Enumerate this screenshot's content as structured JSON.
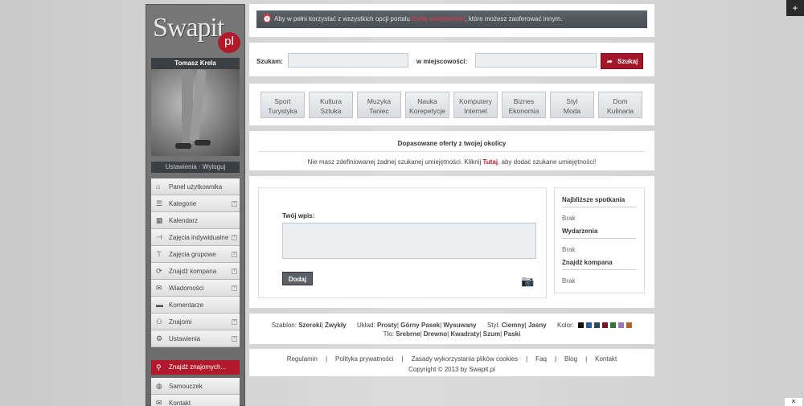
{
  "corner": {
    "top_label": "+",
    "bottom_label": "✕"
  },
  "sidebar": {
    "logo_text": "Swapit",
    "logo_badge": "pl",
    "user_name": "Tomasz Krela",
    "user_links": "Ustawienia · Wyloguj",
    "menu": [
      {
        "label": "Panel użytkownika",
        "icon": "home-icon",
        "glyph": "⌂",
        "expandable": false
      },
      {
        "label": "Kategorie",
        "icon": "list-icon",
        "glyph": "☰",
        "expandable": true
      },
      {
        "label": "Kalendarz",
        "icon": "calendar-icon",
        "glyph": "▦",
        "expandable": false
      },
      {
        "label": "Zajęcia indywidualne",
        "icon": "signpost-icon",
        "glyph": "⊣",
        "expandable": true
      },
      {
        "label": "Zajęcia grupowe",
        "icon": "signpost-icon",
        "glyph": "⊤",
        "expandable": true
      },
      {
        "label": "Znajdź kompana",
        "icon": "refresh-icon",
        "glyph": "⟳",
        "expandable": true
      },
      {
        "label": "Wiadomości",
        "icon": "mail-icon",
        "glyph": "✉",
        "expandable": true
      },
      {
        "label": "Komentarze",
        "icon": "comment-icon",
        "glyph": "▬",
        "expandable": false
      },
      {
        "label": "Znajomi",
        "icon": "users-icon",
        "glyph": "⚇",
        "expandable": true
      },
      {
        "label": "Ustawienia",
        "icon": "gear-icon",
        "glyph": "⚙",
        "expandable": true
      }
    ],
    "find_friends_placeholder": "Znajdź znajomych...",
    "menu2": [
      {
        "label": "Samouczek",
        "icon": "globe-icon",
        "glyph": "◍"
      },
      {
        "label": "Kontakt",
        "icon": "mail-icon",
        "glyph": "✉"
      }
    ]
  },
  "notice": {
    "prefix": "Aby w pełni korzystać z wszystkich opcji portalu ",
    "link": "dodaj umiejętności",
    "suffix": ", które możesz zaoferować innym."
  },
  "search": {
    "label": "Szukam:",
    "location_label": "w miejscowości:",
    "button": "Szukaj"
  },
  "categories": [
    {
      "line1": "Sport",
      "line2": "Turystyka"
    },
    {
      "line1": "Kultura",
      "line2": "Sztuka"
    },
    {
      "line1": "Muzyka",
      "line2": "Taniec"
    },
    {
      "line1": "Nauka",
      "line2": "Korepetycje"
    },
    {
      "line1": "Komputery",
      "line2": "Internet"
    },
    {
      "line1": "Biznes",
      "line2": "Ekonomia"
    },
    {
      "line1": "Styl",
      "line2": "Moda"
    },
    {
      "line1": "Dom",
      "line2": "Kulinaria"
    }
  ],
  "offers": {
    "title": "Dopasowane oferty z twojej okolicy",
    "text_prefix": "Nie masz zdefiniowanej żadnej szukanej umiejętności. Kliknij ",
    "link": "Tutaj",
    "text_suffix": ", aby dodać szukane umiejętności!"
  },
  "wall": {
    "label": "Twój wpis:",
    "button": "Dodaj"
  },
  "side": {
    "sections": [
      {
        "title": "Najbliższe spotkania",
        "value": "Brak"
      },
      {
        "title": "Wydarzenia",
        "value": "Brak"
      },
      {
        "title": "Znajdź kompana",
        "value": "Brak"
      }
    ]
  },
  "options": {
    "template_label": "Szablon:",
    "template_a": "Szeroki",
    "template_b": "Zwykły",
    "layout_label": "Układ:",
    "layout_a": "Prosty",
    "layout_b": "Górny Pasek",
    "layout_c": "Wysuwany",
    "style_label": "Styl:",
    "style_a": "Ciemny",
    "style_b": "Jasny",
    "color_label": "Kolor:",
    "colors": [
      "#111111",
      "#2a5a9a",
      "#2d4a5e",
      "#7a1525",
      "#2f7a3a",
      "#9a77b8",
      "#b5632a"
    ],
    "bg_label": "Tło:",
    "bg_items": [
      "Srebrne",
      "Drewno",
      "Kwadraty",
      "Szum",
      "Paski"
    ]
  },
  "footer": {
    "links": [
      "Regulamin",
      "Polityka prywatności",
      "Zasady wykorzystania plików cookies",
      "Faq",
      "Blog",
      "Kontakt"
    ],
    "copyright": "Copyright © 2013 by Swapit.pl"
  }
}
